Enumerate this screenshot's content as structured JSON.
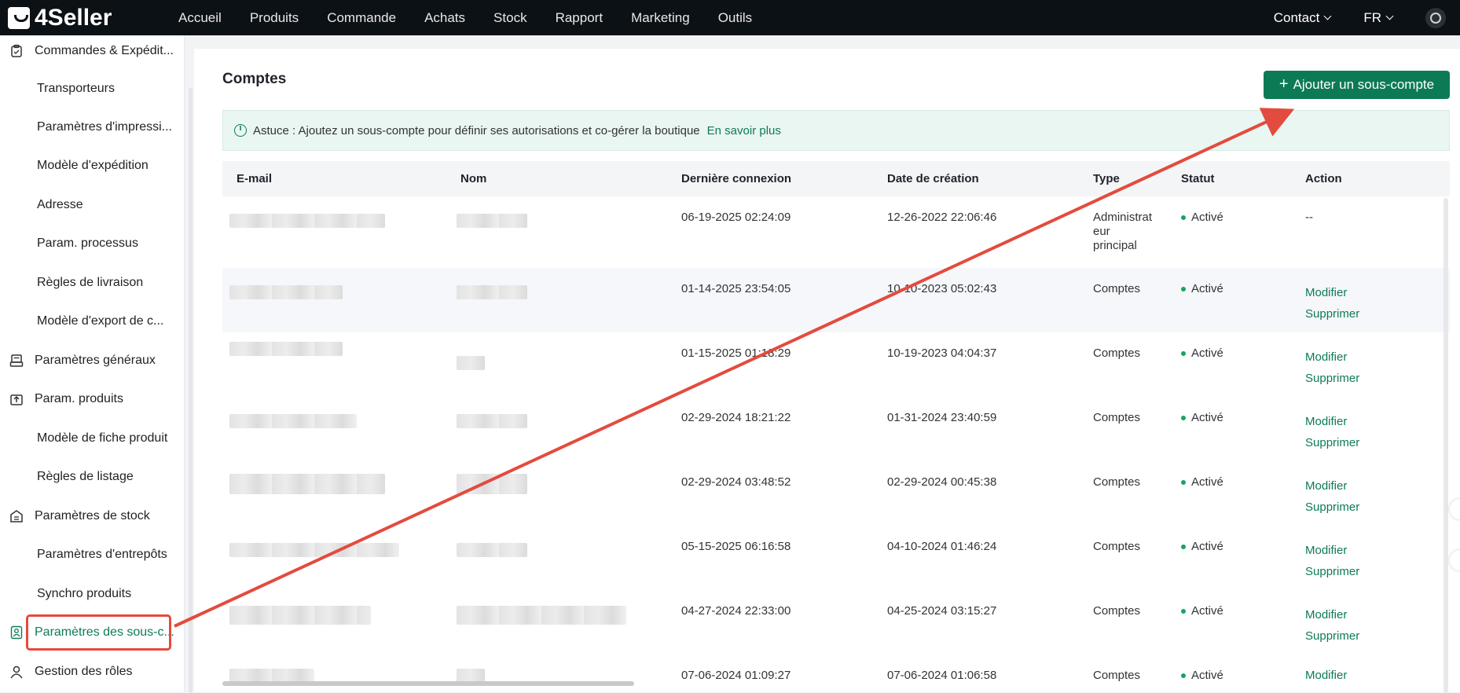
{
  "topbar": {
    "logo": "4Seller",
    "nav": [
      "Accueil",
      "Produits",
      "Commande",
      "Achats",
      "Stock",
      "Rapport",
      "Marketing",
      "Outils"
    ],
    "contact": "Contact",
    "language": "FR"
  },
  "sidebar": {
    "items": [
      {
        "label": "Commandes & Expédit...",
        "kind": "cat",
        "icon": "clipboard-icon"
      },
      {
        "label": "Transporteurs",
        "kind": "sub"
      },
      {
        "label": "Paramètres d'impressi...",
        "kind": "sub"
      },
      {
        "label": "Modèle d'expédition",
        "kind": "sub"
      },
      {
        "label": "Adresse",
        "kind": "sub"
      },
      {
        "label": "Param. processus",
        "kind": "sub"
      },
      {
        "label": "Règles de livraison",
        "kind": "sub"
      },
      {
        "label": "Modèle d'export de c...",
        "kind": "sub"
      },
      {
        "label": "Paramètres généraux",
        "kind": "cat",
        "icon": "printer-icon"
      },
      {
        "label": "Param. produits",
        "kind": "cat",
        "icon": "upload-box-icon"
      },
      {
        "label": "Modèle de fiche produit",
        "kind": "sub"
      },
      {
        "label": "Règles de listage",
        "kind": "sub"
      },
      {
        "label": "Paramètres de stock",
        "kind": "cat",
        "icon": "warehouse-icon"
      },
      {
        "label": "Paramètres d'entrepôts",
        "kind": "sub"
      },
      {
        "label": "Synchro produits",
        "kind": "sub"
      },
      {
        "label": "Paramètres des sous-c...",
        "kind": "cat",
        "icon": "subaccount-icon",
        "active": true
      },
      {
        "label": "Gestion des rôles",
        "kind": "cat",
        "icon": "user-icon"
      }
    ]
  },
  "main": {
    "title": "Comptes",
    "add_button": "Ajouter un sous-compte",
    "tip_text": "Astuce : Ajoutez un sous-compte pour définir ses autorisations et co-gérer la boutique",
    "tip_link": "En savoir plus",
    "columns": [
      "E-mail",
      "Nom",
      "Dernière connexion",
      "Date de création",
      "Type",
      "Statut",
      "Action"
    ],
    "rows": [
      {
        "last_login": "06-19-2025 02:24:09",
        "created": "12-26-2022 22:06:46",
        "type": "Administrat eur principal",
        "status": "Activé",
        "action": "--"
      },
      {
        "last_login": "01-14-2025 23:54:05",
        "created": "10-10-2023 05:02:43",
        "type": "Comptes",
        "status": "Activé",
        "modify": "Modifier",
        "delete": "Supprimer"
      },
      {
        "last_login": "01-15-2025 01:18:29",
        "created": "10-19-2023 04:04:37",
        "type": "Comptes",
        "status": "Activé",
        "modify": "Modifier",
        "delete": "Supprimer"
      },
      {
        "last_login": "02-29-2024 18:21:22",
        "created": "01-31-2024 23:40:59",
        "type": "Comptes",
        "status": "Activé",
        "modify": "Modifier",
        "delete": "Supprimer"
      },
      {
        "last_login": "02-29-2024 03:48:52",
        "created": "02-29-2024 00:45:38",
        "type": "Comptes",
        "status": "Activé",
        "modify": "Modifier",
        "delete": "Supprimer"
      },
      {
        "last_login": "05-15-2025 06:16:58",
        "created": "04-10-2024 01:46:24",
        "type": "Comptes",
        "status": "Activé",
        "modify": "Modifier",
        "delete": "Supprimer"
      },
      {
        "last_login": "04-27-2024 22:33:00",
        "created": "04-25-2024 03:15:27",
        "type": "Comptes",
        "status": "Activé",
        "modify": "Modifier",
        "delete": "Supprimer"
      },
      {
        "last_login": "07-06-2024 01:09:27",
        "created": "07-06-2024 01:06:58",
        "type": "Comptes",
        "status": "Activé",
        "modify": "Modifier",
        "delete": ""
      }
    ]
  },
  "colors": {
    "accent": "#0d7a56",
    "annotation": "#e34b3e",
    "topbar": "#0c1116"
  }
}
